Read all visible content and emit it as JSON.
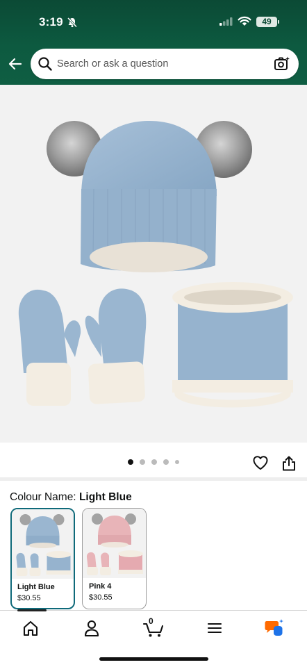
{
  "status_bar": {
    "time": "3:19",
    "battery": "49"
  },
  "search": {
    "placeholder": "Search or ask a question"
  },
  "gallery": {
    "image_count": 5,
    "active_index": 0
  },
  "product": {
    "colour_label": "Colour Name:",
    "colour_value": "Light Blue",
    "variants": [
      {
        "name": "Light Blue",
        "price": "$30.55",
        "selected": true
      },
      {
        "name": "Pink 4",
        "price": "$30.55",
        "selected": false
      }
    ]
  },
  "nav": {
    "items": [
      "home-icon",
      "account-icon",
      "cart-icon",
      "menu-icon",
      "rufus-icon"
    ],
    "cart_count": "0"
  },
  "colors": {
    "header": "#0d5a40",
    "selected_border": "#0f6a7a",
    "product_blue": "#9ab6d0",
    "product_pink": "#e8b4b8",
    "rufus_orange": "#ff6a00",
    "rufus_blue": "#1e73e8"
  }
}
